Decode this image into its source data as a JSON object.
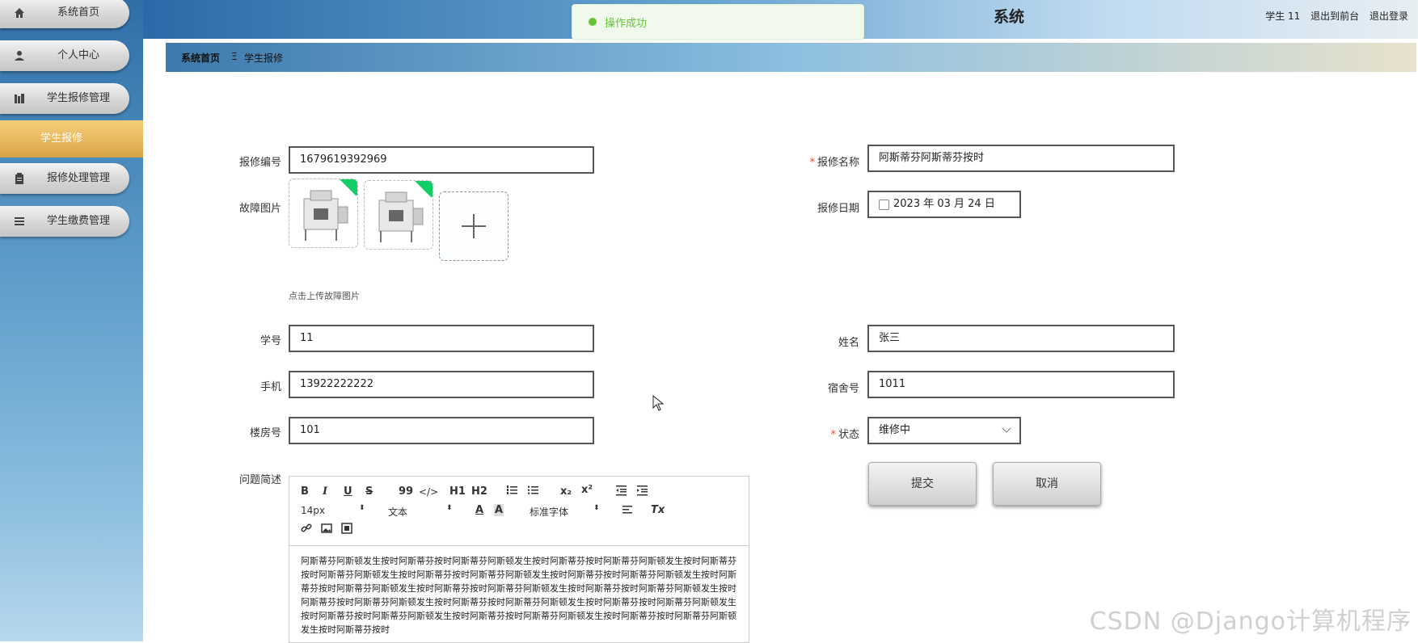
{
  "sidebar": {
    "items": [
      {
        "label": "系统首页",
        "icon": "home-icon"
      },
      {
        "label": "个人中心",
        "icon": "user-icon"
      },
      {
        "label": "学生报修管理",
        "icon": "chart-icon"
      },
      {
        "label": "报修处理管理",
        "icon": "clipboard-icon"
      },
      {
        "label": "学生缴费管理",
        "icon": "list-icon"
      }
    ],
    "submenu_active": "学生报修"
  },
  "header": {
    "title": "系统",
    "user": "学生 11",
    "to_front": "退出到前台",
    "logout": "退出登录"
  },
  "toast": {
    "message": "操作成功"
  },
  "breadcrumb": {
    "home": "系统首页",
    "separator": "Ξ",
    "current": "学生报修"
  },
  "form": {
    "repair_no_label": "报修编号",
    "repair_no": "1679619392969",
    "repair_name_label": "报修名称",
    "repair_name": "阿斯蒂芬阿斯蒂芬按时",
    "fault_image_label": "故障图片",
    "upload_hint": "点击上传故障图片",
    "repair_date_label": "报修日期",
    "repair_date": "2023 年 03 月 24 日",
    "student_no_label": "学号",
    "student_no": "11",
    "name_label": "姓名",
    "name": "张三",
    "phone_label": "手机",
    "phone": "13922222222",
    "dorm_label": "宿舍号",
    "dorm": "1011",
    "building_label": "楼房号",
    "building": "101",
    "status_label": "状态",
    "status": "维修中",
    "description_label": "问题简述",
    "description": "阿斯蒂芬阿斯顿发生按时阿斯蒂芬按时阿斯蒂芬阿斯顿发生按时阿斯蒂芬按时阿斯蒂芬阿斯顿发生按时阿斯蒂芬按时阿斯蒂芬阿斯顿发生按时阿斯蒂芬按时阿斯蒂芬阿斯顿发生按时阿斯蒂芬按时阿斯蒂芬阿斯顿发生按时阿斯蒂芬按时阿斯蒂芬阿斯顿发生按时阿斯蒂芬按时阿斯蒂芬阿斯顿发生按时阿斯蒂芬按时阿斯蒂芬阿斯顿发生按时阿斯蒂芬按时阿斯蒂芬阿斯顿发生按时阿斯蒂芬按时阿斯蒂芬阿斯顿发生按时阿斯蒂芬按时阿斯蒂芬阿斯顿发生按时阿斯蒂芬按时阿斯蒂芬阿斯顿发生按时阿斯蒂芬按时阿斯蒂芬阿斯顿发生按时阿斯蒂芬按时阿斯蒂芬阿斯顿发生按时阿斯蒂芬按时",
    "submit": "提交",
    "cancel": "取消"
  },
  "editor": {
    "font_size": "14px",
    "paragraph": "文本",
    "font_family": "标准字体",
    "bold": "B",
    "italic": "I",
    "underline": "U",
    "strike": "S",
    "quote": "99",
    "code": "</>",
    "h1": "H1",
    "h2": "H2",
    "sub": "x₂",
    "sup": "x²",
    "clear": "Tx"
  },
  "watermark": "CSDN @Django计算机程序"
}
